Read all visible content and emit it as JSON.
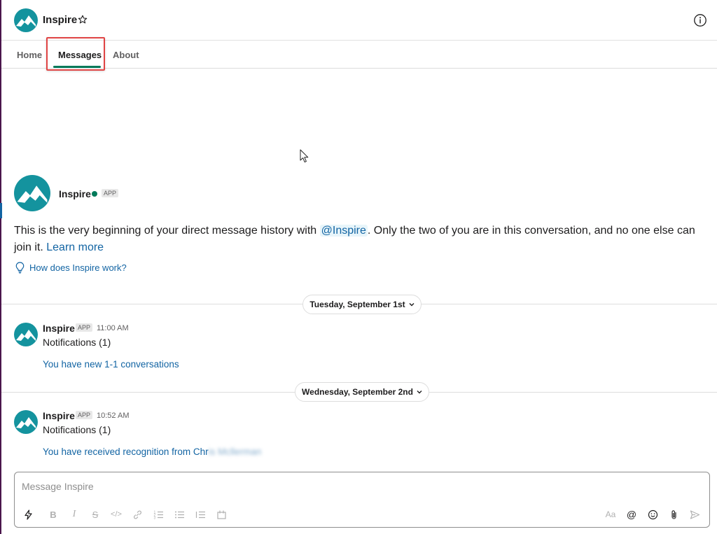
{
  "colors": {
    "brand": "#14939e",
    "link": "#1264a3",
    "presence": "#007a5a",
    "active_tab_underline": "#007a5a",
    "highlight_box": "#e04444"
  },
  "header": {
    "title": "Inspire",
    "star_icon": "star-outline-icon",
    "info_icon": "info-circle-icon"
  },
  "tabs": [
    {
      "label": "Home",
      "active": false
    },
    {
      "label": "Messages",
      "active": true
    },
    {
      "label": "About",
      "active": false
    }
  ],
  "intro": {
    "name": "Inspire",
    "badge": "APP",
    "text_before": "This is the very beginning of your direct message history with ",
    "mention": "@Inspire",
    "text_after": ". Only the two of you are in this conversation, and no one else can join it. ",
    "learn_more": "Learn more",
    "help_link": "How does Inspire work?"
  },
  "dividers": [
    {
      "label": "Tuesday, September 1st"
    },
    {
      "label": "Wednesday, September 2nd"
    }
  ],
  "messages": [
    {
      "sender": "Inspire",
      "badge": "APP",
      "time": "11:00 AM",
      "title": "Notifications (1)",
      "link": "You have new 1-1 conversations",
      "link_blurred": ""
    },
    {
      "sender": "Inspire",
      "badge": "APP",
      "time": "10:52 AM",
      "title": "Notifications (1)",
      "link": "You have received recognition from Chr",
      "link_blurred": "is Mcllerman"
    }
  ],
  "composer": {
    "placeholder": "Message Inspire",
    "tools": [
      "shortcuts-icon",
      "bold-icon",
      "italic-icon",
      "strikethrough-icon",
      "code-icon",
      "link-icon",
      "ordered-list-icon",
      "bulleted-list-icon",
      "blockquote-icon",
      "code-block-icon"
    ],
    "right_tools": [
      "formatting-icon",
      "mention-icon",
      "emoji-icon",
      "attachment-icon",
      "send-icon"
    ],
    "format_label": "Aa"
  }
}
